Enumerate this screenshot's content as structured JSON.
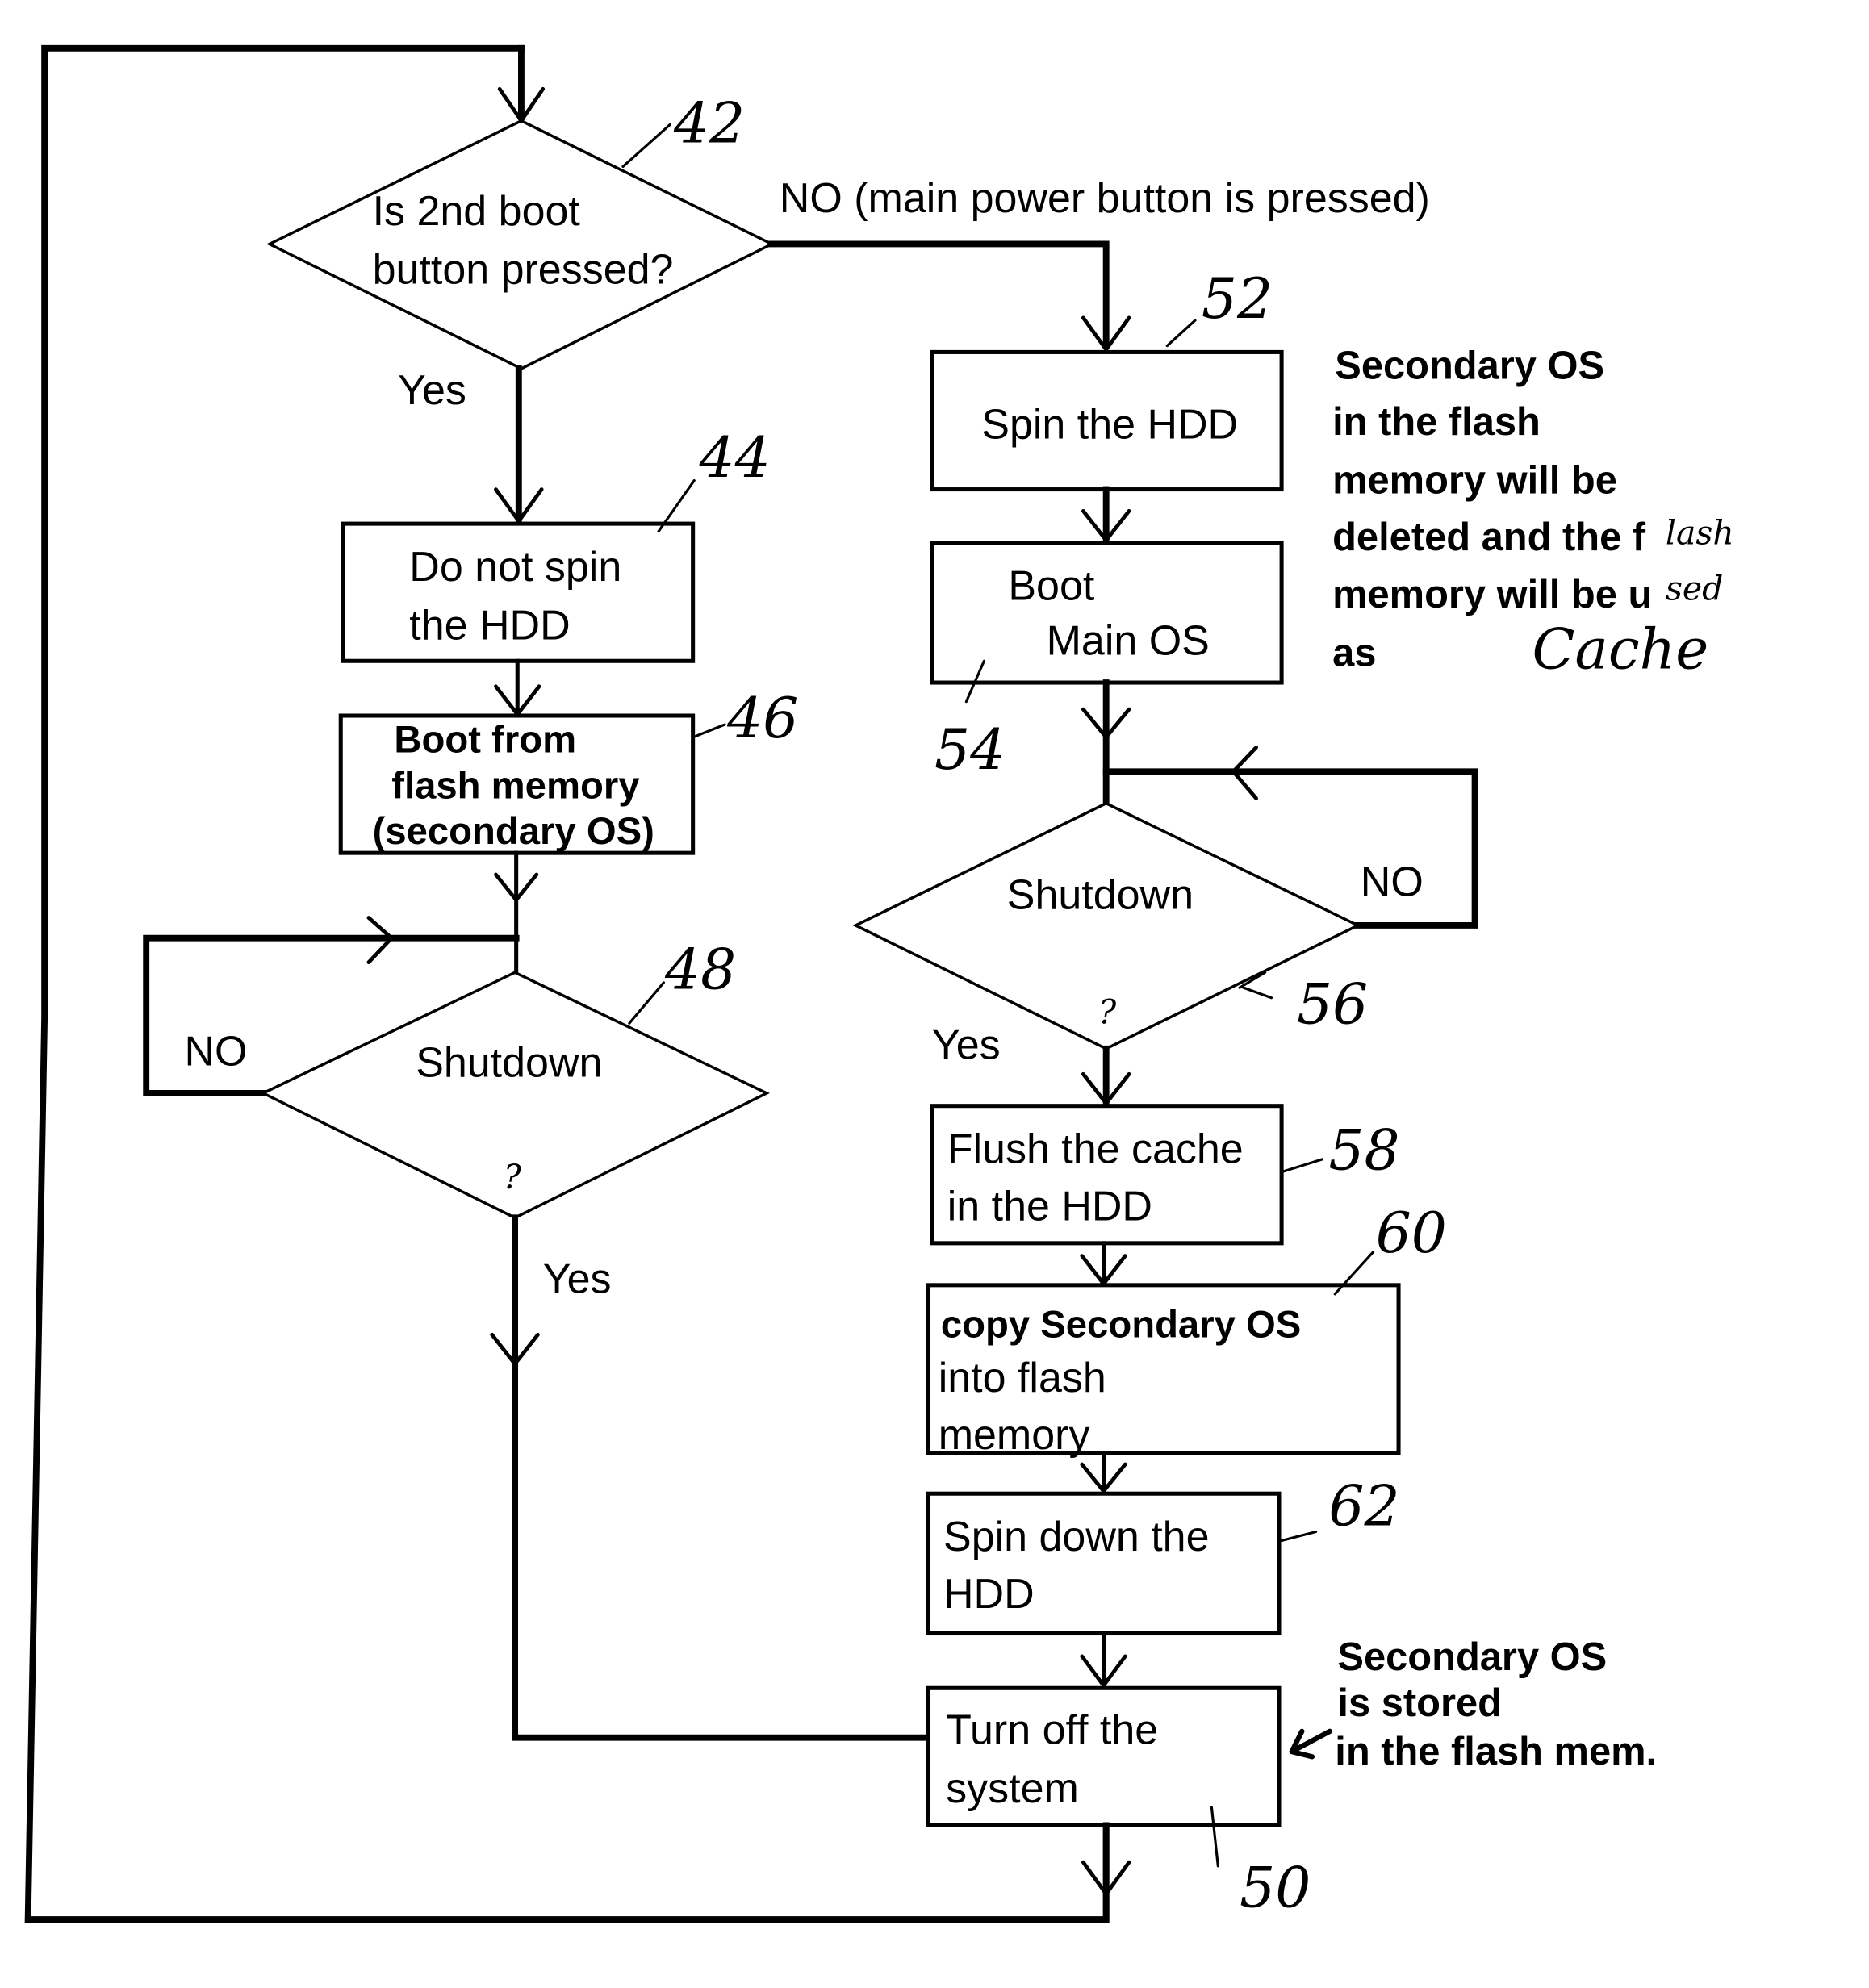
{
  "diagram": {
    "type": "flowchart",
    "nodes": {
      "n42": {
        "ref": "42",
        "shape": "diamond",
        "lines": [
          "Is  2nd boot",
          "button pressed?"
        ]
      },
      "n44": {
        "ref": "44",
        "shape": "box",
        "lines": [
          "Do not spin",
          "the HDD"
        ]
      },
      "n46": {
        "ref": "46",
        "shape": "box",
        "lines": [
          "Boot from",
          "flash memory",
          "(secondary OS)"
        ]
      },
      "n48": {
        "ref": "48",
        "shape": "diamond",
        "lines": [
          "Shutdown",
          "?"
        ]
      },
      "n52": {
        "ref": "52",
        "shape": "box",
        "lines": [
          "Spin the HDD"
        ]
      },
      "n54": {
        "ref": "54",
        "shape": "box",
        "lines": [
          "Boot",
          "Main  OS"
        ]
      },
      "n56": {
        "ref": "56",
        "shape": "diamond",
        "lines": [
          "Shutdown",
          "?"
        ]
      },
      "n58": {
        "ref": "58",
        "shape": "box",
        "lines": [
          "Flush the cache",
          "in the HDD"
        ]
      },
      "n60": {
        "ref": "60",
        "shape": "box",
        "lines": [
          "copy  Secondary OS",
          "into flash",
          "memory"
        ]
      },
      "n62": {
        "ref": "62",
        "shape": "box",
        "lines": [
          "Spin down the",
          "HDD"
        ]
      },
      "n50": {
        "ref": "50",
        "shape": "box",
        "lines": [
          "Turn off the",
          "system"
        ]
      }
    },
    "edge_labels": {
      "n42_no": "NO (main power button is pressed)",
      "n42_yes": "Yes",
      "n48_no": "NO",
      "n48_yes": "Yes",
      "n56_no": "NO",
      "n56_yes": "Yes"
    },
    "edges": [
      {
        "from": "n42",
        "to": "n44",
        "label": "Yes"
      },
      {
        "from": "n42",
        "to": "n52",
        "label": "NO (main power button is pressed)"
      },
      {
        "from": "n44",
        "to": "n46"
      },
      {
        "from": "n46",
        "to": "n48"
      },
      {
        "from": "n48",
        "to": "n48",
        "label": "NO"
      },
      {
        "from": "n48",
        "to": "n50",
        "label": "Yes"
      },
      {
        "from": "n52",
        "to": "n54"
      },
      {
        "from": "n54",
        "to": "n56"
      },
      {
        "from": "n56",
        "to": "n56",
        "label": "NO"
      },
      {
        "from": "n56",
        "to": "n58",
        "label": "Yes"
      },
      {
        "from": "n58",
        "to": "n60"
      },
      {
        "from": "n60",
        "to": "n62"
      },
      {
        "from": "n62",
        "to": "n50"
      },
      {
        "from": "n50",
        "to": "n42"
      }
    ],
    "notes": {
      "top_right": {
        "lines": [
          "Secondary OS",
          "in the flash",
          "memory will be",
          "deleted and the f",
          "memory will be u",
          "as"
        ],
        "handwritten": {
          "flash": "lash",
          "used": "sed",
          "cache": "Cache"
        }
      },
      "bottom_right": {
        "lines": [
          "Secondary OS",
          "is stored",
          "in the flash mem."
        ]
      }
    }
  }
}
